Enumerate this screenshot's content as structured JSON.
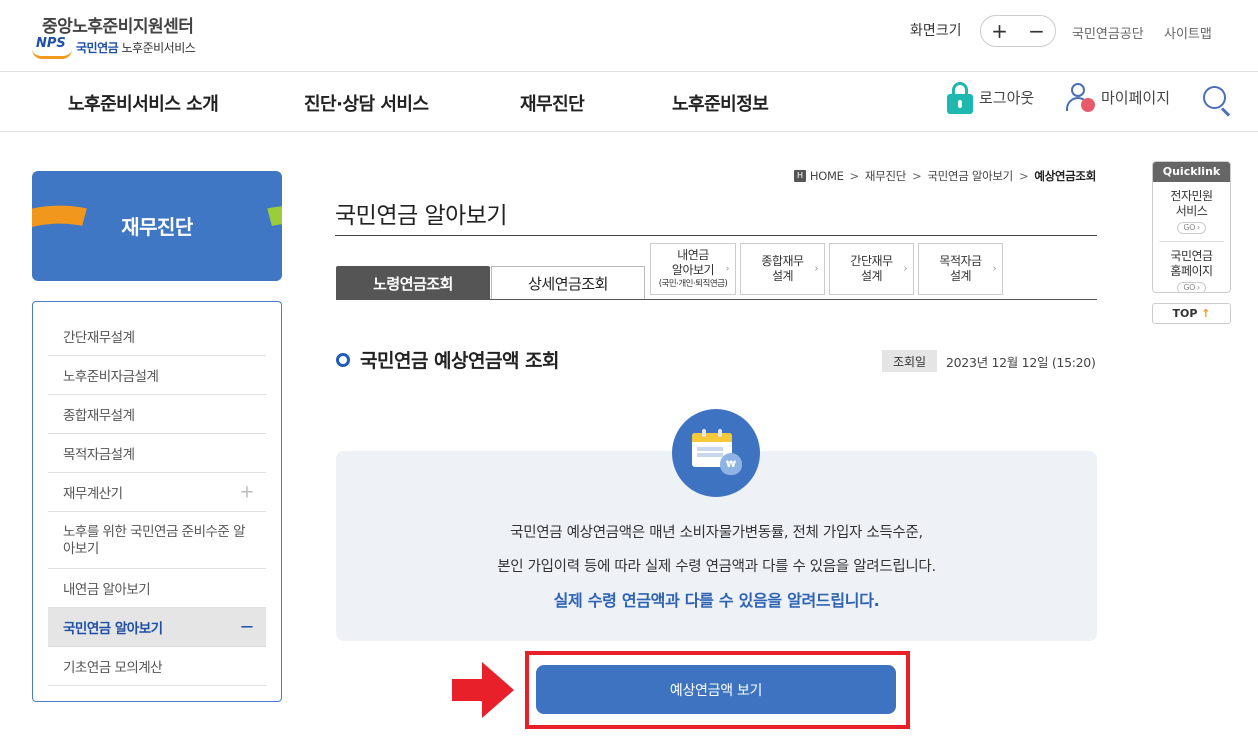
{
  "header": {
    "logo_title": "중앙노후준비지원센터",
    "logo_nps": "NPS",
    "logo_sub_brand": "국민연금",
    "logo_sub_service": "노후준비서비스",
    "zoom_label": "화면크기",
    "zoom_in": "+",
    "zoom_out": "−",
    "links": [
      "국민연금공단",
      "사이트맵"
    ]
  },
  "nav": {
    "items": [
      "노후준비서비스 소개",
      "진단·상담 서비스",
      "재무진단",
      "노후준비정보"
    ],
    "logout": "로그아웃",
    "mypage": "마이페이지"
  },
  "sidebar": {
    "banner_title": "재무진단",
    "items": [
      {
        "label": "간단재무설계",
        "toggle": ""
      },
      {
        "label": "노후준비자금설계",
        "toggle": ""
      },
      {
        "label": "종합재무설계",
        "toggle": ""
      },
      {
        "label": "목적자금설계",
        "toggle": ""
      },
      {
        "label": "재무계산기",
        "toggle": "+"
      },
      {
        "label": "노후를 위한 국민연금 준비수준 알아보기",
        "toggle": ""
      },
      {
        "label": "내연금 알아보기",
        "toggle": ""
      },
      {
        "label": "국민연금 알아보기",
        "toggle": "−"
      },
      {
        "label": "기초연금 모의계산",
        "toggle": ""
      }
    ],
    "active_index": 7
  },
  "breadcrumb": {
    "home": "HOME",
    "items": [
      "재무진단",
      "국민연금 알아보기",
      "예상연금조회"
    ],
    "separator": ">"
  },
  "page_title": "국민연금 알아보기",
  "tabs": {
    "active": "노령연금조회",
    "inactive": "상세연금조회",
    "quick": [
      {
        "line1": "내연금",
        "line2": "알아보기",
        "note": "(국민·개인·퇴직연금)"
      },
      {
        "line1": "종합재무",
        "line2": "설계",
        "note": ""
      },
      {
        "line1": "간단재무",
        "line2": "설계",
        "note": ""
      },
      {
        "line1": "목적자금",
        "line2": "설계",
        "note": ""
      }
    ]
  },
  "section": {
    "title": "국민연금 예상연금액 조회",
    "date_label": "조회일",
    "date_value": "2023년 12월 12일 (15:20)"
  },
  "info": {
    "line1": "국민연금 예상연금액은 매년 소비자물가변동률, 전체 가입자 소득수준,",
    "line2": "본인 가입이력 등에 따라 실제 수령 연금액과 다를 수 있음을 알려드립니다.",
    "line3": "실제 수령 연금액과 다를 수 있음을 알려드립니다.",
    "coin_symbol": "₩"
  },
  "action": {
    "button_label": "예상연금액 보기"
  },
  "quicklink": {
    "title": "Quicklink",
    "items": [
      {
        "line1": "전자민원",
        "line2": "서비스",
        "go": "GO"
      },
      {
        "line1": "국민연금",
        "line2": "홈페이지",
        "go": "GO"
      }
    ],
    "top_label": "TOP",
    "top_arrow": "↑"
  },
  "colors": {
    "brand_blue": "#3e73c2",
    "highlight_red": "#e8202a",
    "accent_orange": "#f0971c",
    "accent_green": "#9ccc3a"
  }
}
